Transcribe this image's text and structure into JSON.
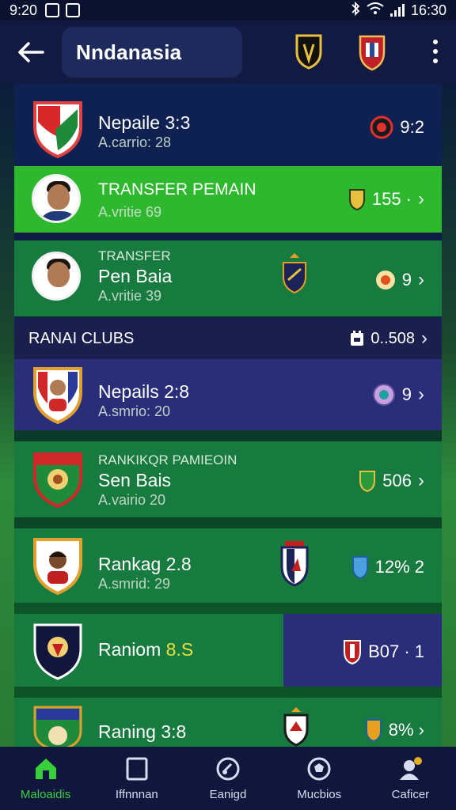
{
  "status": {
    "time_left": "9:20",
    "time_right": "16:30"
  },
  "header": {
    "title": "Nndanasia"
  },
  "rows": [
    {
      "primary": "Nepaile 3:3",
      "secondary": "A.carrio: 28",
      "value": "9:2",
      "bg": "#0f2150"
    },
    {
      "kicker": "TRANSFER PEMAIN",
      "secondary": "A.vritie 69",
      "value": "155 ·",
      "bg": "#2db82e"
    },
    {
      "kicker": "TRANSFER",
      "primary": "Pen Baia",
      "secondary": "A.vritie 39",
      "value": "9",
      "bg": "#177a3e"
    },
    {
      "primary": "Nepails 2:8",
      "secondary": "A.smrio: 20",
      "value": "9",
      "bg": "#2a2d78"
    },
    {
      "kicker": "RANKIKQR PAMIEOIN",
      "primary": "Sen Bais",
      "secondary": "A.vairio 20",
      "value": "506",
      "bg": "#177a3e"
    },
    {
      "primary": "Rankag 2.8",
      "secondary": "A.smrid: 29",
      "value": "12% 2",
      "bg": "#177a3e"
    },
    {
      "primary": "Raniom",
      "primary_highlight": "8.S",
      "value": "B07 · 1",
      "bg": "#177a3e",
      "bg_right": "#2a2d78"
    },
    {
      "primary": "Raning 3:8",
      "value": "8% ›",
      "bg": "#177a3e"
    }
  ],
  "section": {
    "title": "RANAI CLUBS",
    "value": "0..508"
  },
  "nav": [
    {
      "label": "Maloaidis",
      "icon": "home-icon",
      "active": true
    },
    {
      "label": "Iffnnnan",
      "icon": "square-icon",
      "active": false
    },
    {
      "label": "Eanigd",
      "icon": "whistle-icon",
      "active": false
    },
    {
      "label": "Mucbios",
      "icon": "ball-icon",
      "active": false
    },
    {
      "label": "Caficer",
      "icon": "profile-icon",
      "active": false
    }
  ],
  "colors": {
    "accent_green": "#37d03c",
    "header_bg": "#121a42",
    "nav_bg": "#10163c"
  }
}
